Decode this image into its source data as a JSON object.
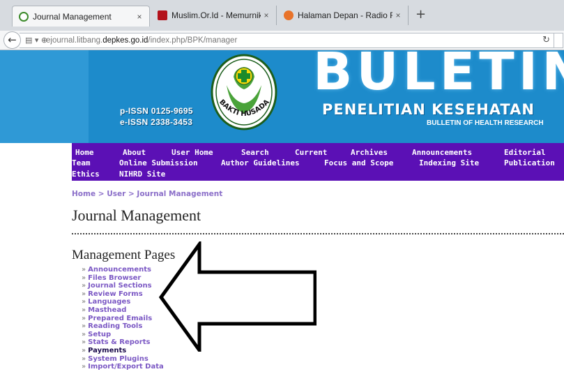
{
  "browser": {
    "tabs": [
      {
        "title": "Journal Management",
        "active": true,
        "favicon_color": "#3b8a2a"
      },
      {
        "title": "Muslim.Or.Id - Memurnika...",
        "active": false,
        "favicon_color": "#b3121b"
      },
      {
        "title": "Halaman Depan - Radio Ro...",
        "active": false,
        "favicon_color": "#e8732a"
      }
    ],
    "tab_close": "×",
    "new_tab": "+",
    "url_prefix": "ejournal.litbang.",
    "url_domain": "depkes.go.id",
    "url_path": "/index.php/BPK/manager"
  },
  "banner": {
    "p_issn": "p-ISSN 0125-9695",
    "e_issn": "e-ISSN 2338-3453",
    "logo_text": "BAKTI HUSADA",
    "title": "BULETIN",
    "subtitle": "PENELITIAN KESEHATAN",
    "english_title": "BULLETIN OF HEALTH RESEARCH"
  },
  "menu": {
    "row1": [
      "Home",
      "About",
      "User Home",
      "Search",
      "Current",
      "Archives",
      "Announcements",
      "Editorial"
    ],
    "row2": [
      "Team",
      "Online Submission",
      "Author Guidelines",
      "Focus and Scope",
      "Indexing Site",
      "Publication"
    ],
    "row3": [
      "Ethics",
      "NIHRD Site"
    ]
  },
  "breadcrumb": {
    "home": "Home",
    "sep": ">",
    "user": "User",
    "current": "Journal Management"
  },
  "page_title": "Journal Management",
  "section_title": "Management Pages",
  "bullet": "»",
  "management_links": [
    "Announcements",
    "Files Browser",
    "Journal Sections",
    "Review Forms",
    "Languages",
    "Masthead",
    "Prepared Emails",
    "Reading Tools",
    "Setup",
    "Stats & Reports",
    "Payments",
    "System Plugins",
    "Import/Export Data"
  ],
  "colors": {
    "banner_blue": "#1d8bcb",
    "menu_purple": "#5b10b5",
    "link_purple": "#7b58c4"
  }
}
